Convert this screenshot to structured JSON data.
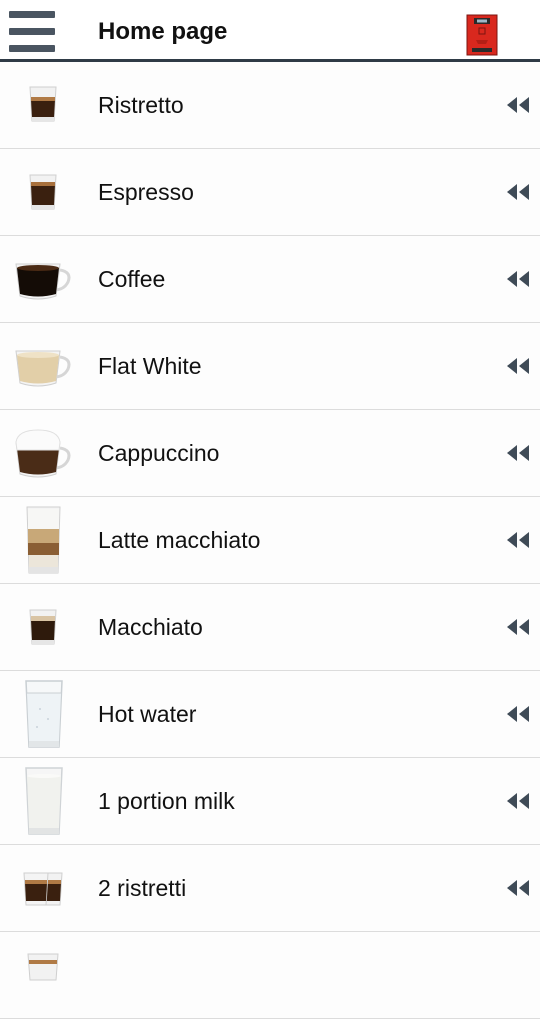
{
  "header": {
    "title": "Home page",
    "menu_icon": "hamburger-menu-icon",
    "machine_icon": "coffee-machine-icon"
  },
  "products": [
    {
      "label": "Ristretto",
      "icon": "ristretto-glass-icon"
    },
    {
      "label": "Espresso",
      "icon": "espresso-glass-icon"
    },
    {
      "label": "Coffee",
      "icon": "coffee-cup-icon"
    },
    {
      "label": "Flat White",
      "icon": "flat-white-cup-icon"
    },
    {
      "label": "Cappuccino",
      "icon": "cappuccino-cup-icon"
    },
    {
      "label": "Latte macchiato",
      "icon": "latte-macchiato-glass-icon"
    },
    {
      "label": "Macchiato",
      "icon": "macchiato-glass-icon"
    },
    {
      "label": "Hot water",
      "icon": "hot-water-glass-icon"
    },
    {
      "label": "1 portion milk",
      "icon": "milk-glass-icon"
    },
    {
      "label": "2 ristretti",
      "icon": "two-ristretti-glasses-icon"
    }
  ],
  "row_action_icon": "rewind-arrows-icon",
  "colors": {
    "header_rule": "#2f3b46",
    "icon_gray": "#4a5561",
    "machine_red": "#d9281e",
    "divider": "#dcdcdc"
  }
}
